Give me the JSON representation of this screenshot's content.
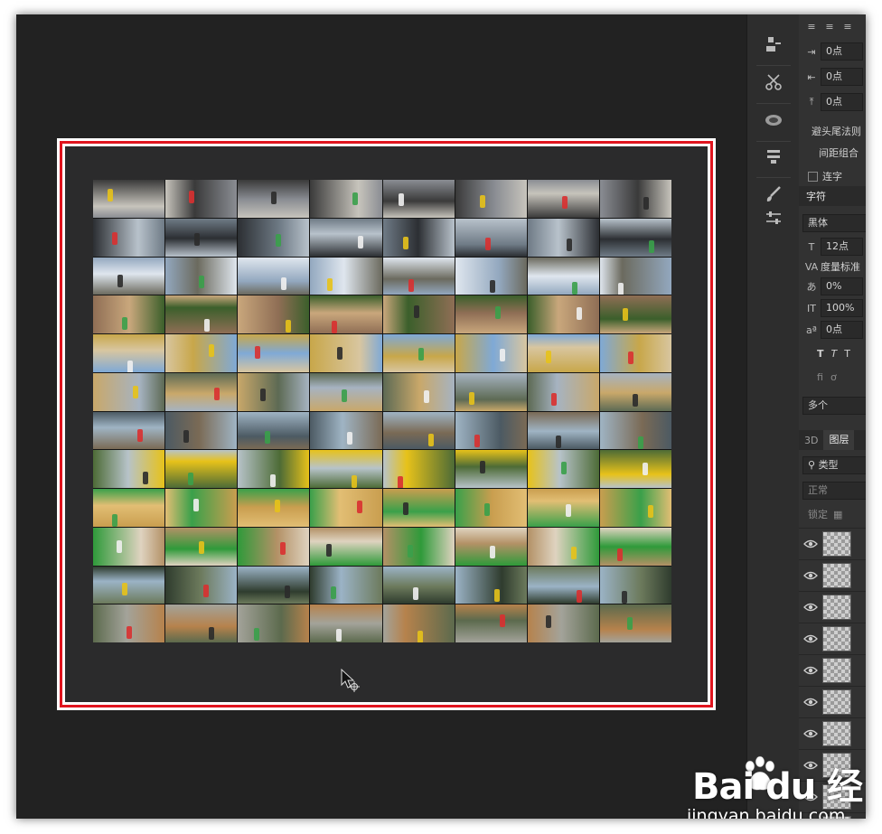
{
  "properties_panel": {
    "indent_left": "0点",
    "indent_right": "0点",
    "space_before": "0点",
    "hanging_punct": "避头尾法则",
    "spacing_combo": "间距组合",
    "hyphenate_label": "连字",
    "char_tab": "字符",
    "font_family": "黑体",
    "font_size": "12点",
    "kerning": "度量标准",
    "tracking": "0%",
    "vertical_scale": "100%",
    "baseline_shift": "0点",
    "language": "多个"
  },
  "layers_panel": {
    "tabs": [
      "3D",
      "图层"
    ],
    "filter_kind": "类型",
    "blend_mode": "正常",
    "lock_label": "锁定",
    "layer_count_visible": 10
  },
  "canvas": {
    "contact_sheet_columns": 8,
    "contact_sheet_rows": 12
  },
  "watermark": {
    "logo": "Bai du 经验",
    "url": "jingyan.baidu.com"
  },
  "colors": {
    "window_bg": "#222222",
    "panel_bg": "#323232",
    "selection_frame": "#e0141e",
    "artboard_bg": "#2b2b2c"
  }
}
